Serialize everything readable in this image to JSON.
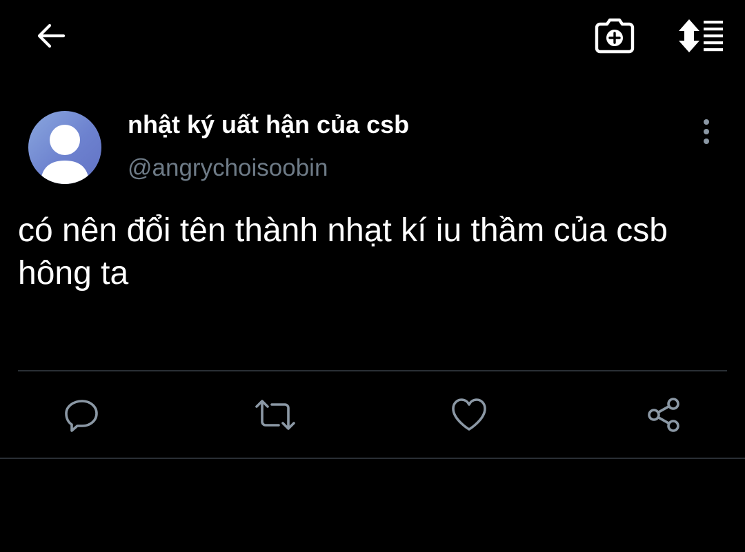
{
  "toolbar": {
    "back_icon": "arrow-left-icon",
    "camera_icon": "camera-add-icon",
    "sort_icon": "sort-list-icon"
  },
  "tweet": {
    "display_name": "nhật ký uất hận của csb",
    "handle": "@angrychoisoobin",
    "text": "có nên đổi tên thành nhạt kí iu thầm của csb hông ta",
    "more_icon": "more-vertical-icon"
  },
  "actions": {
    "reply_icon": "reply-icon",
    "retweet_icon": "retweet-icon",
    "like_icon": "heart-icon",
    "share_icon": "share-icon"
  },
  "colors": {
    "background": "#000000",
    "primary_text": "#ffffff",
    "secondary_text": "#6e7b87",
    "action_icon": "#8b98a5",
    "divider": "#2a2f35",
    "avatar_blue": "#6d82cf"
  }
}
